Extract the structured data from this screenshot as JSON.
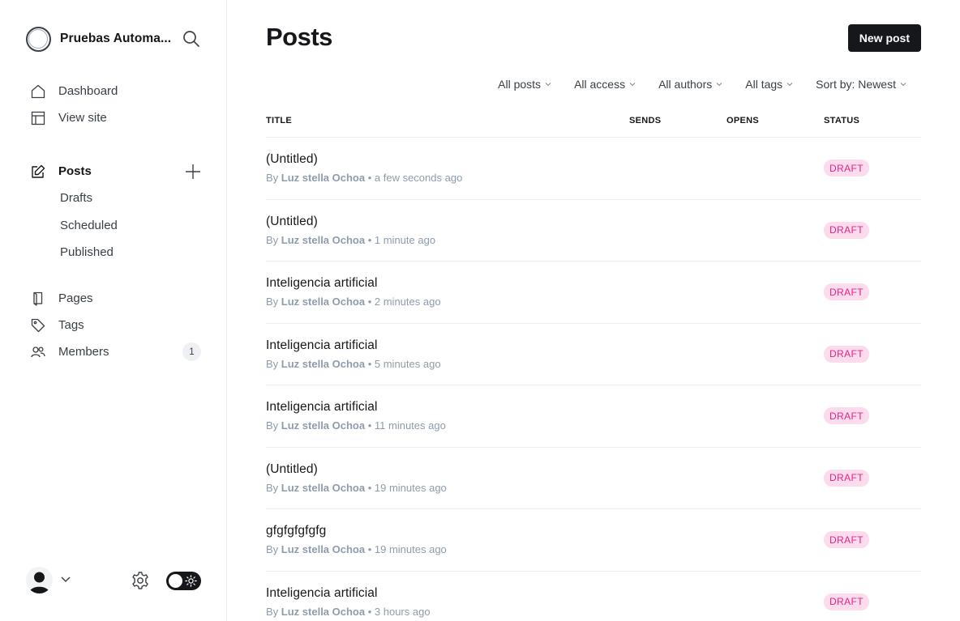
{
  "sidebar": {
    "site_name": "Pruebas Automa...",
    "nav": {
      "dashboard": "Dashboard",
      "view_site": "View site",
      "posts": "Posts",
      "drafts": "Drafts",
      "scheduled": "Scheduled",
      "published": "Published",
      "pages": "Pages",
      "tags": "Tags",
      "members": "Members",
      "members_count": "1"
    }
  },
  "header": {
    "title": "Posts",
    "new_post_label": "New post"
  },
  "filters": {
    "type": "All posts",
    "access": "All access",
    "authors": "All authors",
    "tags": "All tags",
    "sort": "Sort by: Newest"
  },
  "columns": {
    "title": "TITLE",
    "sends": "SENDS",
    "opens": "OPENS",
    "status": "STATUS"
  },
  "posts": [
    {
      "title": "(Untitled)",
      "by": "By",
      "author": "Luz stella Ochoa",
      "time": "a few seconds ago",
      "status": "DRAFT"
    },
    {
      "title": "(Untitled)",
      "by": "By",
      "author": "Luz stella Ochoa",
      "time": "1 minute ago",
      "status": "DRAFT"
    },
    {
      "title": "Inteligencia artificial",
      "by": "By",
      "author": "Luz stella Ochoa",
      "time": "2 minutes ago",
      "status": "DRAFT"
    },
    {
      "title": "Inteligencia artificial",
      "by": "By",
      "author": "Luz stella Ochoa",
      "time": "5 minutes ago",
      "status": "DRAFT"
    },
    {
      "title": "Inteligencia artificial",
      "by": "By",
      "author": "Luz stella Ochoa",
      "time": "11 minutes ago",
      "status": "DRAFT"
    },
    {
      "title": "(Untitled)",
      "by": "By",
      "author": "Luz stella Ochoa",
      "time": "19 minutes ago",
      "status": "DRAFT"
    },
    {
      "title": "gfgfgfgfgfg",
      "by": "By",
      "author": "Luz stella Ochoa",
      "time": "19 minutes ago",
      "status": "DRAFT"
    },
    {
      "title": "Inteligencia artificial",
      "by": "By",
      "author": "Luz stella Ochoa",
      "time": "3 hours ago",
      "status": "DRAFT"
    }
  ],
  "colors": {
    "primary": "#15171a",
    "muted": "#8e9cac",
    "draft_bg": "#fcdcec",
    "draft_text": "#e1248a",
    "border": "#ebeef0"
  },
  "icons": [
    "site-logo-icon",
    "search-icon",
    "home-icon",
    "view-site-icon",
    "posts-edit-icon",
    "plus-icon",
    "pages-icon",
    "tag-icon",
    "members-icon",
    "avatar-icon",
    "chevron-down-icon",
    "gear-icon",
    "sun-icon"
  ]
}
